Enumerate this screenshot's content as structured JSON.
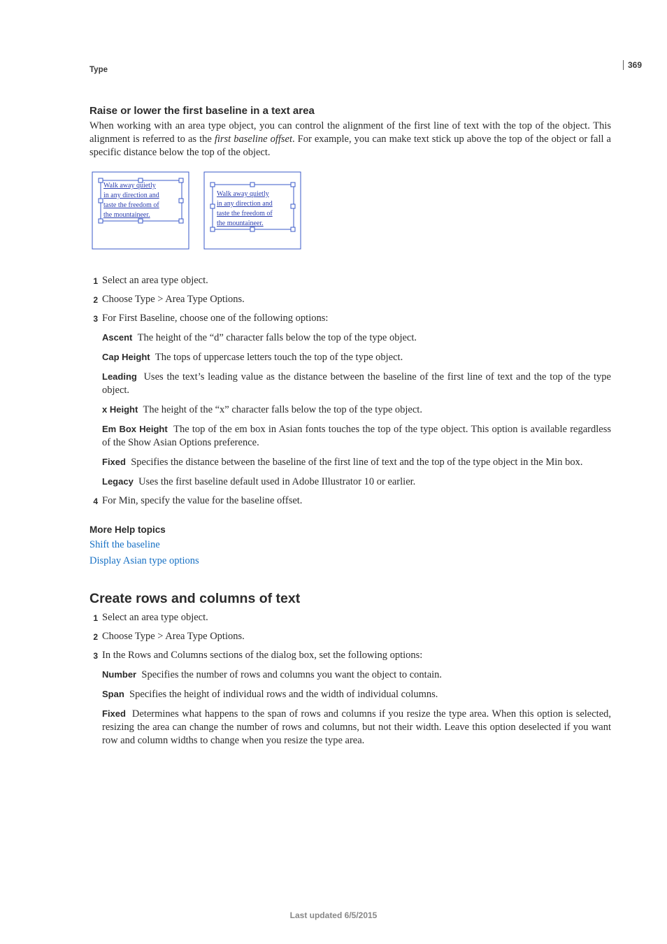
{
  "page_section": "Type",
  "page_number": "369",
  "section1": {
    "heading": "Raise or lower the first baseline in a text area",
    "intro_html": "When working with an area type object, you can control the alignment of the first line of text with the top of the object. This alignment is referred to as the <em>first baseline offset</em>. For example, you can make text stick up above the top of the object or fall a specific distance below the top of the object.",
    "figure": {
      "lines": [
        "Walk away quietly",
        "in any direction and",
        "taste the freedom of",
        "the mountaineer."
      ]
    },
    "steps": [
      "Select an area type object.",
      "Choose Type > Area Type Options.",
      "For First Baseline, choose one of the following options:"
    ],
    "options": [
      {
        "label": "Ascent",
        "text": "The height of the “d” character falls below the top of the type object."
      },
      {
        "label": "Cap Height",
        "text": "The tops of uppercase letters touch the top of the type object."
      },
      {
        "label": "Leading",
        "text": "Uses the text’s leading value as the distance between the baseline of the first line of text and the top of the type object."
      },
      {
        "label": "x Height",
        "text": "The height of the “x” character falls below the top of the type object."
      },
      {
        "label": "Em Box Height",
        "text": "The top of the em box in Asian fonts touches the top of the type object. This option is available regardless of the Show Asian Options preference."
      },
      {
        "label": "Fixed",
        "text": "Specifies the distance between the baseline of the first line of text and the top of the type object in the Min box."
      },
      {
        "label": "Legacy",
        "text": "Uses the first baseline default used in Adobe Illustrator 10 or earlier."
      }
    ],
    "step4": "For Min, specify the value for the baseline offset.",
    "more_help_heading": "More Help topics",
    "links": [
      "Shift the baseline",
      "Display Asian type options"
    ]
  },
  "section2": {
    "heading": "Create rows and columns of text",
    "steps": [
      "Select an area type object.",
      "Choose Type > Area Type Options.",
      "In the Rows and Columns sections of the dialog box, set the following options:"
    ],
    "options": [
      {
        "label": "Number",
        "text": "Specifies the number of rows and columns you want the object to contain."
      },
      {
        "label": "Span",
        "text": "Specifies the height of individual rows and the width of individual columns."
      },
      {
        "label": "Fixed",
        "text": "Determines what happens to the span of rows and columns if you resize the type area. When this option is selected, resizing the area can change the number of rows and columns, but not their width. Leave this option deselected if you want row and column widths to change when you resize the type area."
      }
    ]
  },
  "footer": "Last updated 6/5/2015"
}
